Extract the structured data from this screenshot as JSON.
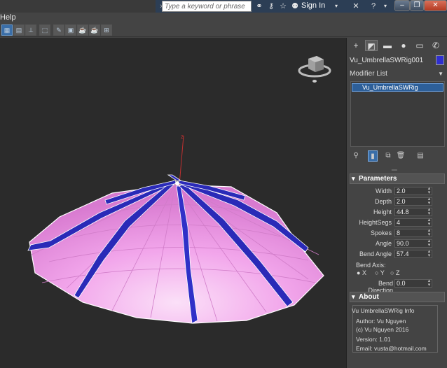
{
  "titlebar": {
    "search_placeholder": "Type a keyword or phrase",
    "signin_label": "Sign In",
    "icons": [
      "binoculars-icon",
      "key-icon",
      "star-icon",
      "user-icon",
      "exchange-icon",
      "help-icon"
    ],
    "window_buttons": [
      "minimize",
      "restore",
      "close"
    ]
  },
  "menubar": {
    "help_label": "Help"
  },
  "toolbar": {
    "tools": [
      "layout-icon",
      "layout-2-icon",
      "align-icon",
      "select-icon",
      "snap-icon",
      "render-setup-icon",
      "render-frame-icon",
      "render-icon",
      "layout-grid-icon"
    ]
  },
  "panel": {
    "tabs": [
      "create-tab",
      "modify-tab",
      "hierarchy-tab",
      "motion-tab",
      "display-tab",
      "utilities-tab"
    ],
    "object_name": "Vu_UmbrellaSWRig001",
    "object_color": "#2f2fd0",
    "modifier_list_label": "Modifier List",
    "stack_items": [
      "Vu_UmbrellaSWRig"
    ],
    "parameters": {
      "title": "Parameters",
      "fields": [
        {
          "label": "Width",
          "value": "2.0"
        },
        {
          "label": "Depth",
          "value": "2.0"
        },
        {
          "label": "Height",
          "value": "44.8"
        },
        {
          "label": "HeightSegs",
          "value": "4"
        },
        {
          "label": "Spokes",
          "value": "8"
        },
        {
          "label": "Angle",
          "value": "90.0"
        },
        {
          "label": "Bend Angle",
          "value": "57.4"
        }
      ],
      "bend_axis_label": "Bend Axis:",
      "axis_options": [
        "X",
        "Y",
        "Z"
      ],
      "axis_selected": "X",
      "bend_direction_label": "Bend Direction",
      "bend_direction_value": "0.0"
    },
    "about": {
      "title": "About",
      "heading": "Vu UmbrellaSWRig Info",
      "author": "Author: Vu Nguyen",
      "copyright": "(c) Vu Nguyen 2016",
      "version": "Version: 1.01",
      "email": "Email: vusta@hotmail.com"
    }
  },
  "viewport": {
    "axis_label": "z",
    "canopy_color": "#f2a0ea",
    "rib_color": "#2a2ab8"
  }
}
